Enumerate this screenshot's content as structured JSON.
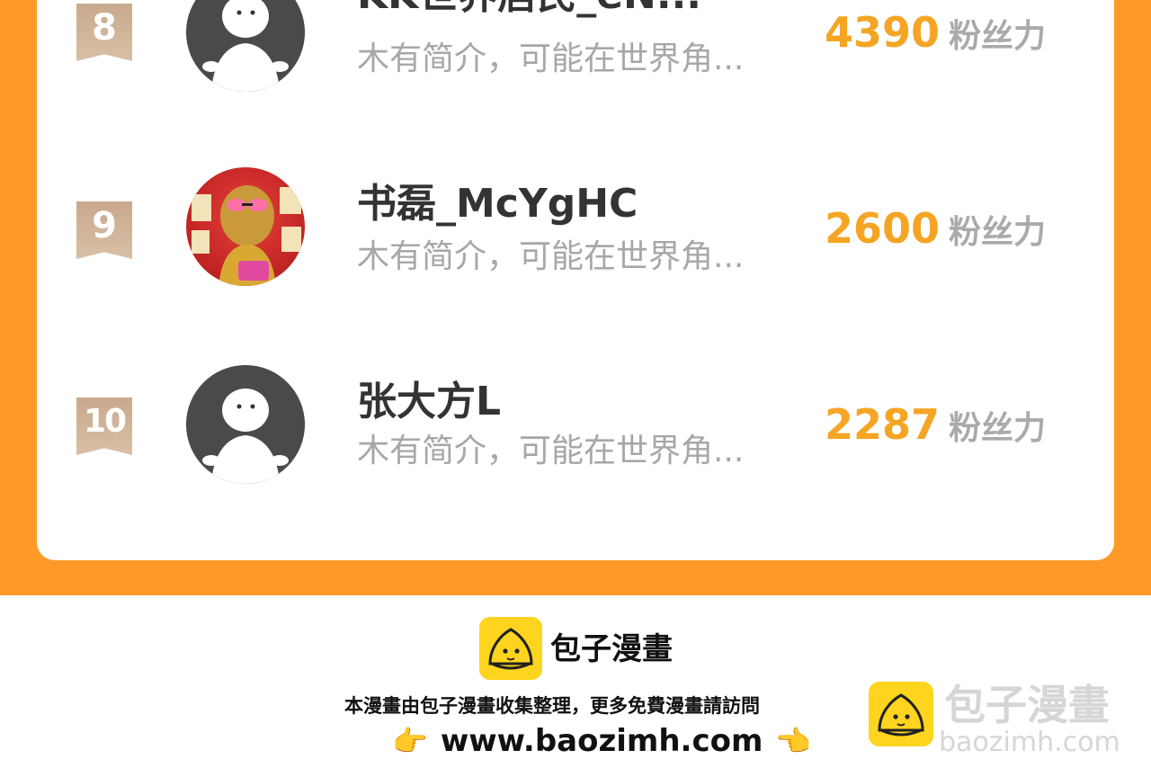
{
  "ranking": {
    "fans_label": "粉丝力",
    "entries": [
      {
        "rank": "8",
        "name": "KK世界居民_eN...",
        "bio": "木有简介，可能在世界角...",
        "fans": "4390",
        "avatar": "default-avatar"
      },
      {
        "rank": "9",
        "name": "书磊_McYgHC",
        "bio": "木有简介，可能在世界角...",
        "fans": "2600",
        "avatar": "photo-avatar"
      },
      {
        "rank": "10",
        "name": "张大方L",
        "bio": "木有简介，可能在世界角...",
        "fans": "2287",
        "avatar": "default-avatar"
      }
    ]
  },
  "footer": {
    "brand": "包子漫畫",
    "note": "本漫畫由包子漫畫收集整理，更多免費漫畫請訪問",
    "url": "www.baozimh.com",
    "left_hand": "👉",
    "right_hand": "👈"
  },
  "watermark": {
    "title": "包子漫畫",
    "url": "baozimh.com"
  },
  "colors": {
    "orange_background": "#ff9a28",
    "fans_number": "#f5a524",
    "rank_badge": "#cdb096",
    "logo_yellow": "#ffd41e"
  }
}
